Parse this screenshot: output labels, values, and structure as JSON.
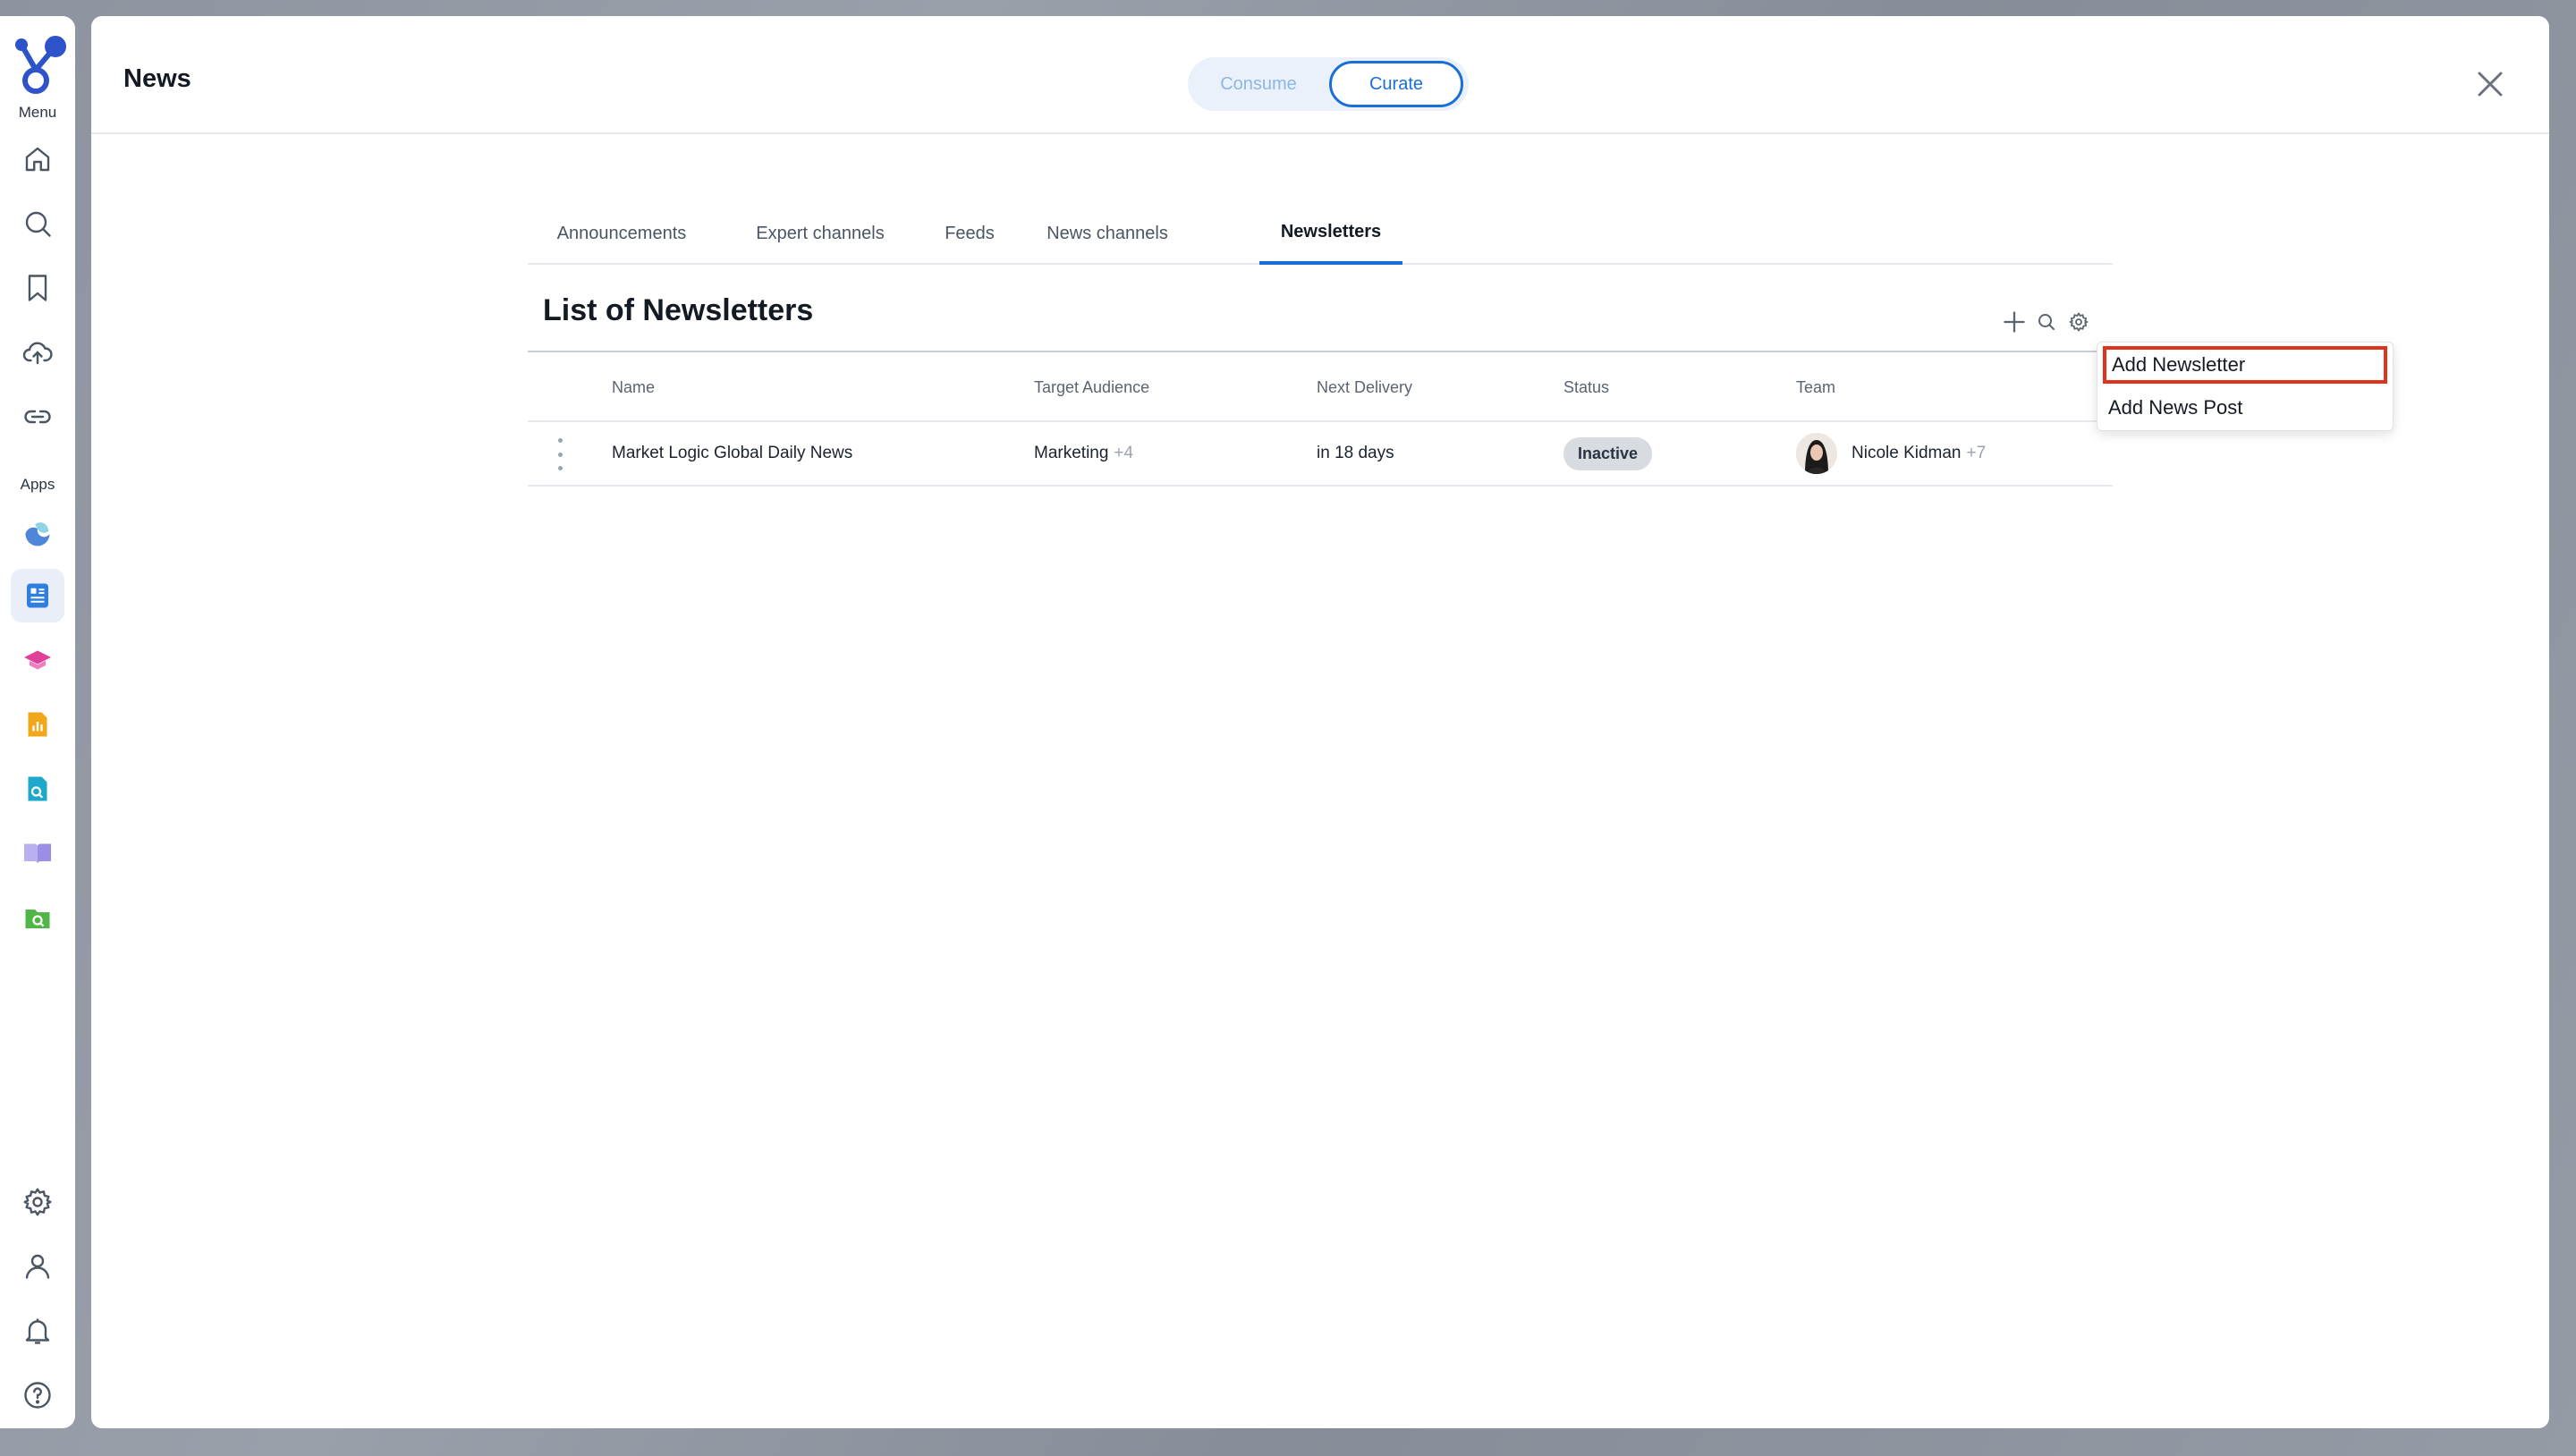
{
  "sidebar": {
    "menu_label": "Menu",
    "apps_label": "Apps",
    "menu_items": [
      {
        "name": "home-icon"
      },
      {
        "name": "search-icon"
      },
      {
        "name": "bookmark-icon"
      },
      {
        "name": "upload-cloud-icon"
      },
      {
        "name": "link-icon"
      }
    ],
    "apps": [
      {
        "name": "weather-app-icon",
        "color": "#4e86d9"
      },
      {
        "name": "news-app-icon",
        "color": "#2f7fe0",
        "active": true
      },
      {
        "name": "learning-app-icon",
        "color": "#e0409a"
      },
      {
        "name": "reports-app-icon",
        "color": "#f0a81a"
      },
      {
        "name": "doc-search-app-icon",
        "color": "#1ea8c9"
      },
      {
        "name": "book-app-icon",
        "color": "#9a8ee6"
      },
      {
        "name": "folder-search-app-icon",
        "color": "#52b548"
      }
    ],
    "bottom_items": [
      {
        "name": "settings-icon"
      },
      {
        "name": "user-icon"
      },
      {
        "name": "notifications-icon"
      },
      {
        "name": "help-icon"
      }
    ]
  },
  "header": {
    "title": "News",
    "modes": {
      "consume": "Consume",
      "curate": "Curate",
      "selected": "Curate"
    }
  },
  "tabs": [
    {
      "label": "Announcements"
    },
    {
      "label": "Expert channels"
    },
    {
      "label": "Feeds"
    },
    {
      "label": "News channels"
    },
    {
      "label": "Newsletters",
      "active": true
    }
  ],
  "list": {
    "title": "List of Newsletters",
    "columns": [
      "Name",
      "Target Audience",
      "Next Delivery",
      "Status",
      "Team"
    ],
    "rows": [
      {
        "name": "Market Logic Global Daily News",
        "audience": "Marketing",
        "audience_more": "+4",
        "next_delivery": "in 18 days",
        "status": "Inactive",
        "team_lead": "Nicole Kidman",
        "team_more": "+7"
      }
    ]
  },
  "add_menu": {
    "items": [
      "Add Newsletter",
      "Add News Post"
    ],
    "highlighted": "Add Newsletter"
  },
  "colors": {
    "accent": "#1a6fd6",
    "highlight_border": "#e0321c",
    "status_badge": "#d8dbe0"
  }
}
